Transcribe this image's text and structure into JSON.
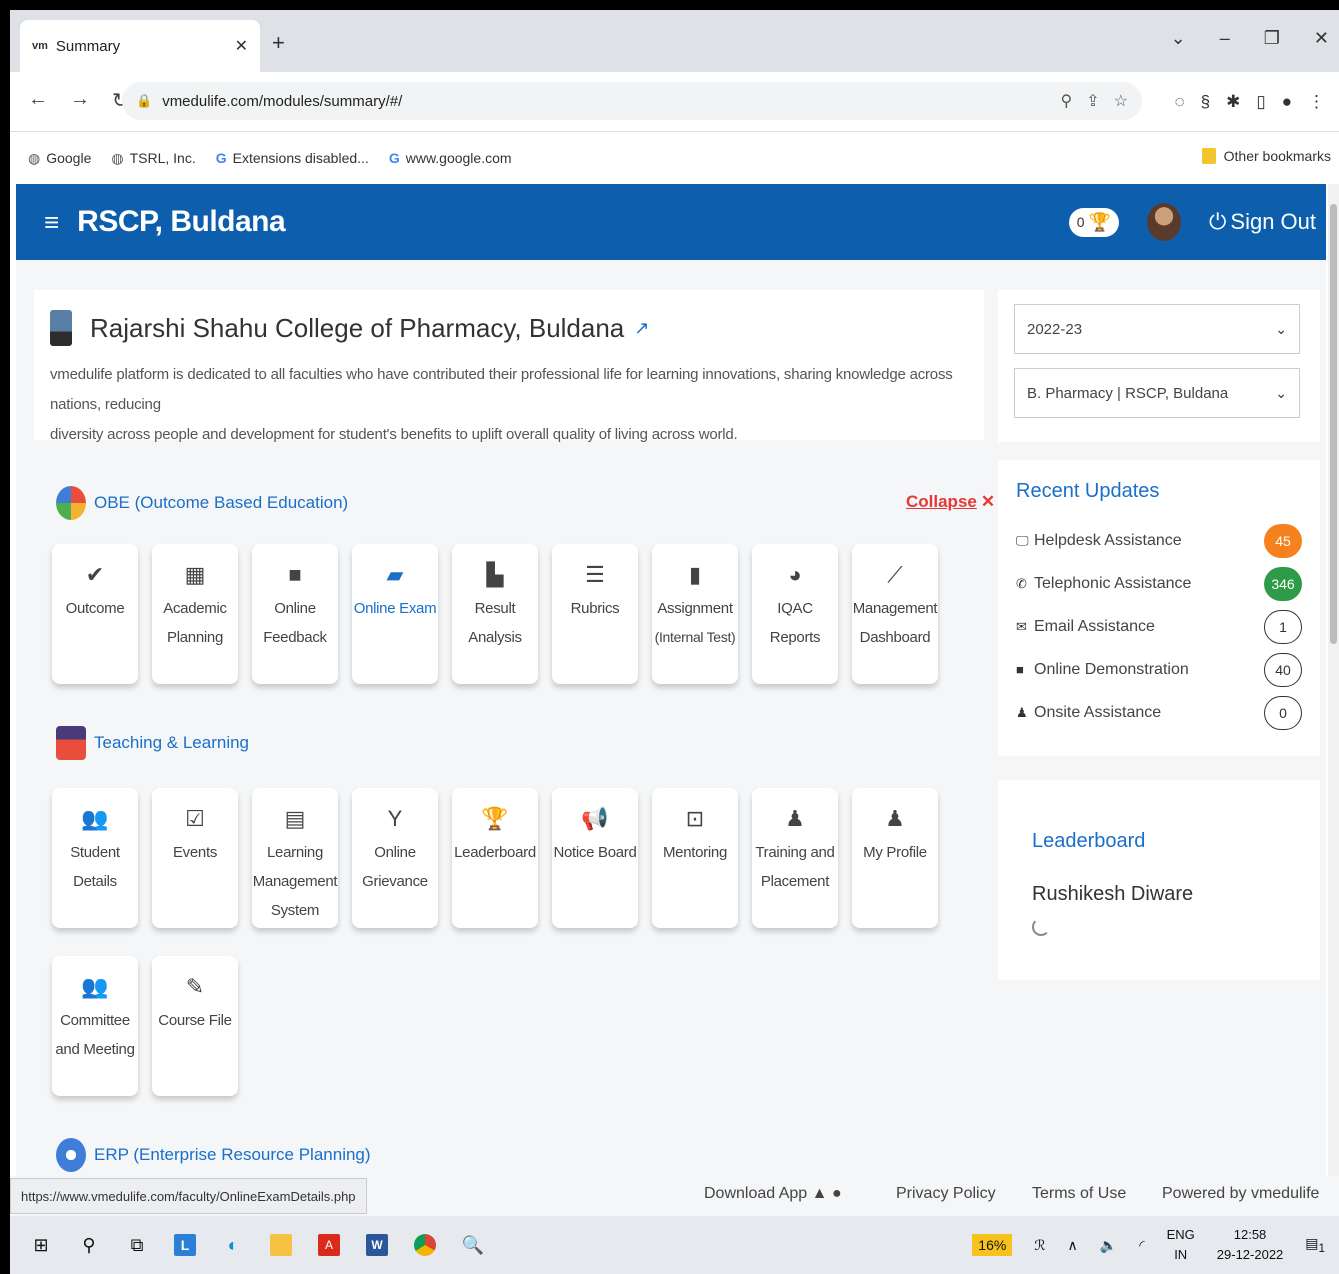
{
  "browser": {
    "tab_title": "Summary",
    "tab_favicon": "vm",
    "url": "vmedulife.com/modules/summary/#/",
    "bookmarks": [
      "Google",
      "TSRL, Inc.",
      "Extensions disabled...",
      "www.google.com"
    ],
    "other_bookmarks": "Other bookmarks"
  },
  "header": {
    "title": "RSCP, Buldana",
    "trophy_count": "0",
    "sign_out": "Sign Out"
  },
  "intro": {
    "college_name": "Rajarshi Shahu College of Pharmacy, Buldana",
    "description_line1": "vmedulife platform is dedicated to all faculties who have contributed their professional life for learning innovations, sharing knowledge across nations, reducing",
    "description_line2": "diversity across people and development for student's benefits to uplift overall quality of living across world."
  },
  "selectors": {
    "year": "2022-23",
    "program": "B. Pharmacy | RSCP, Buldana"
  },
  "obe": {
    "title": "OBE (Outcome Based Education)",
    "collapse": "Collapse",
    "tiles": [
      {
        "line1": "Outcome",
        "line2": "",
        "icon": "check-icon",
        "glyph": "✔"
      },
      {
        "line1": "Academic",
        "line2": "Planning",
        "icon": "calendar-icon",
        "glyph": "▦"
      },
      {
        "line1": "Online",
        "line2": "Feedback",
        "icon": "comment-icon",
        "glyph": "■"
      },
      {
        "line1": "Online Exam",
        "line2": "",
        "icon": "folder-icon",
        "glyph": "▰"
      },
      {
        "line1": "Result",
        "line2": "Analysis",
        "icon": "chart-icon",
        "glyph": "▙"
      },
      {
        "line1": "Rubrics",
        "line2": "",
        "icon": "list-icon",
        "glyph": "☰"
      },
      {
        "line1": "Assignment",
        "line2": "(Internal Test)",
        "icon": "document-icon",
        "glyph": "▮"
      },
      {
        "line1": "IQAC Reports",
        "line2": "",
        "icon": "pie-chart-icon",
        "glyph": "◕"
      },
      {
        "line1": "Management",
        "line2": "Dashboard",
        "icon": "line-chart-icon",
        "glyph": "⟋"
      }
    ]
  },
  "teaching": {
    "title": "Teaching & Learning",
    "tiles": [
      {
        "line1": "Student",
        "line2": "Details",
        "line3": "",
        "icon": "users-icon",
        "glyph": "👥"
      },
      {
        "line1": "Events",
        "line2": "",
        "line3": "",
        "icon": "calendar-check-icon",
        "glyph": "☑"
      },
      {
        "line1": "Learning",
        "line2": "Management",
        "line3": "System",
        "icon": "book-icon",
        "glyph": "▤"
      },
      {
        "line1": "Online",
        "line2": "Grievance",
        "line3": "",
        "icon": "person-icon",
        "glyph": "Y"
      },
      {
        "line1": "Leaderboard",
        "line2": "",
        "line3": "",
        "icon": "trophy-icon",
        "glyph": "🏆"
      },
      {
        "line1": "Notice Board",
        "line2": "",
        "line3": "",
        "icon": "megaphone-icon",
        "glyph": "📢"
      },
      {
        "line1": "Mentoring",
        "line2": "",
        "line3": "",
        "icon": "chalkboard-icon",
        "glyph": "⊡"
      },
      {
        "line1": "Training and",
        "line2": "Placement",
        "line3": "",
        "icon": "user-tie-icon",
        "glyph": "♟"
      },
      {
        "line1": "My Profile",
        "line2": "",
        "line3": "",
        "icon": "user-icon",
        "glyph": "♟"
      },
      {
        "line1": "Committee",
        "line2": "and Meeting",
        "line3": "",
        "icon": "users-icon",
        "glyph": "👥"
      },
      {
        "line1": "Course File",
        "line2": "",
        "line3": "",
        "icon": "file-edit-icon",
        "glyph": "✎"
      }
    ]
  },
  "erp": {
    "title": "ERP (Enterprise Resource Planning)"
  },
  "updates": {
    "title": "Recent Updates",
    "items": [
      {
        "label": "Helpdesk Assistance",
        "count": "45",
        "icon": "monitor-icon",
        "glyph": "🖵"
      },
      {
        "label": "Telephonic Assistance",
        "count": "346",
        "icon": "phone-icon",
        "glyph": "✆"
      },
      {
        "label": "Email Assistance",
        "count": "1",
        "icon": "envelope-icon",
        "glyph": "✉"
      },
      {
        "label": "Online Demonstration",
        "count": "40",
        "icon": "video-icon",
        "glyph": "■"
      },
      {
        "label": "Onsite Assistance",
        "count": "0",
        "icon": "user-check-icon",
        "glyph": "♟"
      }
    ]
  },
  "leaderboard": {
    "title": "Leaderboard",
    "name": "Rushikesh Diware"
  },
  "footer": {
    "status_url": "https://www.vmedulife.com/faculty/OnlineExamDetails.php",
    "download": "Download App",
    "privacy": "Privacy Policy",
    "terms": "Terms of Use",
    "powered": "Powered by vmedulife"
  },
  "taskbar": {
    "battery": "16%",
    "lang1": "ENG",
    "lang2": "IN",
    "time": "12:58",
    "date": "29-12-2022",
    "notif": "1"
  },
  "colors": {
    "header_blue": "#0d5fae",
    "link_blue": "#1a6fc9",
    "collapse_red": "#e53935",
    "badge_orange": "#f6821f",
    "badge_green": "#2e9b48"
  }
}
